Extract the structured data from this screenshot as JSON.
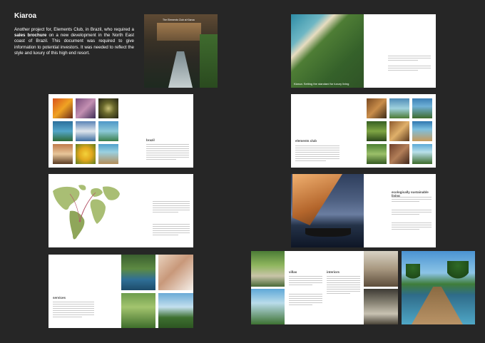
{
  "header": {
    "title": "Kiaroa",
    "intro_pre": "Another project for, Elements Club, in Brazil, who required a ",
    "intro_bold": "sales brochure",
    "intro_post": " on a new development in the North East coast of Brazil. This document was required to give information to potential investors. It was needed to reflect the style and luxury of this high end resort."
  },
  "spreads": {
    "cover": {
      "caption": "The Elements Club at Kiaroa"
    },
    "beach": {
      "caption": "Kiaroa: Setting the standard for luxury living"
    },
    "brazil": {
      "heading": "brazil"
    },
    "elements_club": {
      "heading": "elements club"
    },
    "sustainable": {
      "heading": "ecologically sustainable living"
    },
    "services": {
      "heading": "services"
    },
    "villas": {
      "heading": "villas"
    },
    "interiors": {
      "heading": "interiors"
    }
  },
  "colors": {
    "background": "#262626",
    "page": "#ffffff",
    "map_land": "#a9be74",
    "map_highlight": "#9aaf5c",
    "route_lines": "#b5566b"
  },
  "icons": [
    "world-map-graphic"
  ]
}
